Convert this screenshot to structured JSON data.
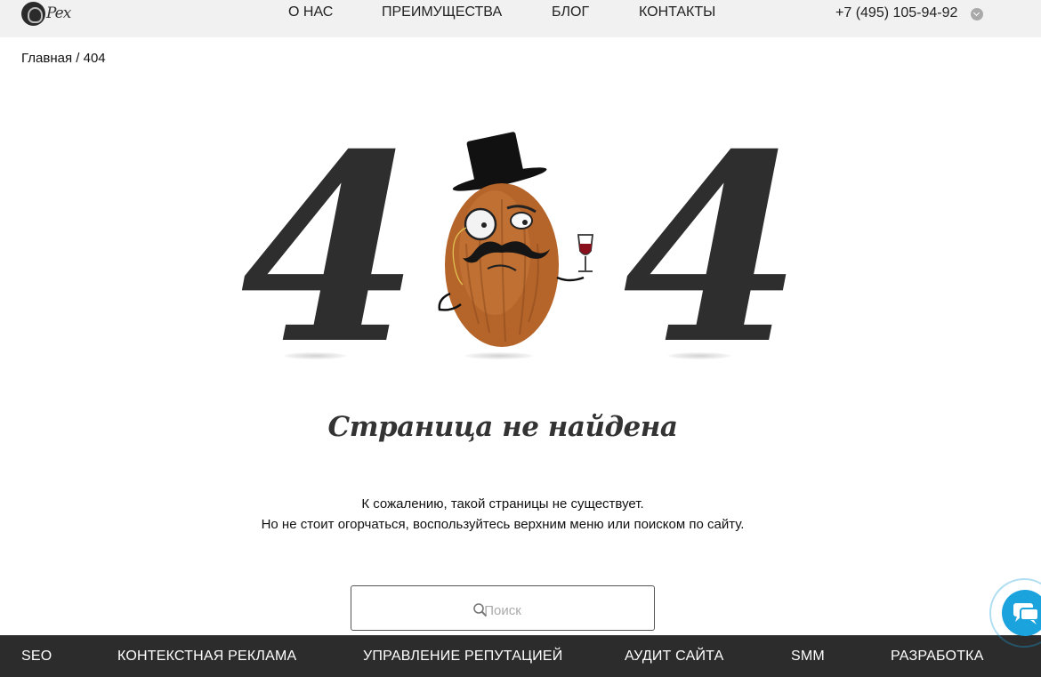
{
  "header": {
    "logo_text": "Pex",
    "nav": [
      "О НАС",
      "ПРЕИМУЩЕСТВА",
      "БЛОГ",
      "КОНТАКТЫ"
    ],
    "phone": "+7 (495) 105-94-92"
  },
  "breadcrumb": {
    "home": "Главная",
    "separator": " / ",
    "current": "404"
  },
  "hero": {
    "digit_left": "4",
    "digit_right": "4"
  },
  "main": {
    "title": "Страница не найдена",
    "message_line1": "К сожалению, такой страницы не существует.",
    "message_line2": "Но не стоит огорчаться, воспользуйтесь верхним меню или поиском по сайту."
  },
  "search": {
    "placeholder": "Поиск",
    "value": ""
  },
  "footer": {
    "nav": [
      "SEO",
      "КОНТЕКСТНАЯ РЕКЛАМА",
      "УПРАВЛЕНИЕ РЕПУТАЦИЕЙ",
      "АУДИТ САЙТА",
      "SMM",
      "РАЗРАБОТКА"
    ]
  },
  "colors": {
    "header_bg": "#f1f1f1",
    "footer_bg": "#2c2c2c",
    "digit": "#2e2e2e",
    "chat_accent": "#1aa3dc"
  },
  "icons": {
    "search": "magnifier-icon",
    "phone_toggle": "chevron-down-icon",
    "chat": "chat-bubble-icon"
  }
}
